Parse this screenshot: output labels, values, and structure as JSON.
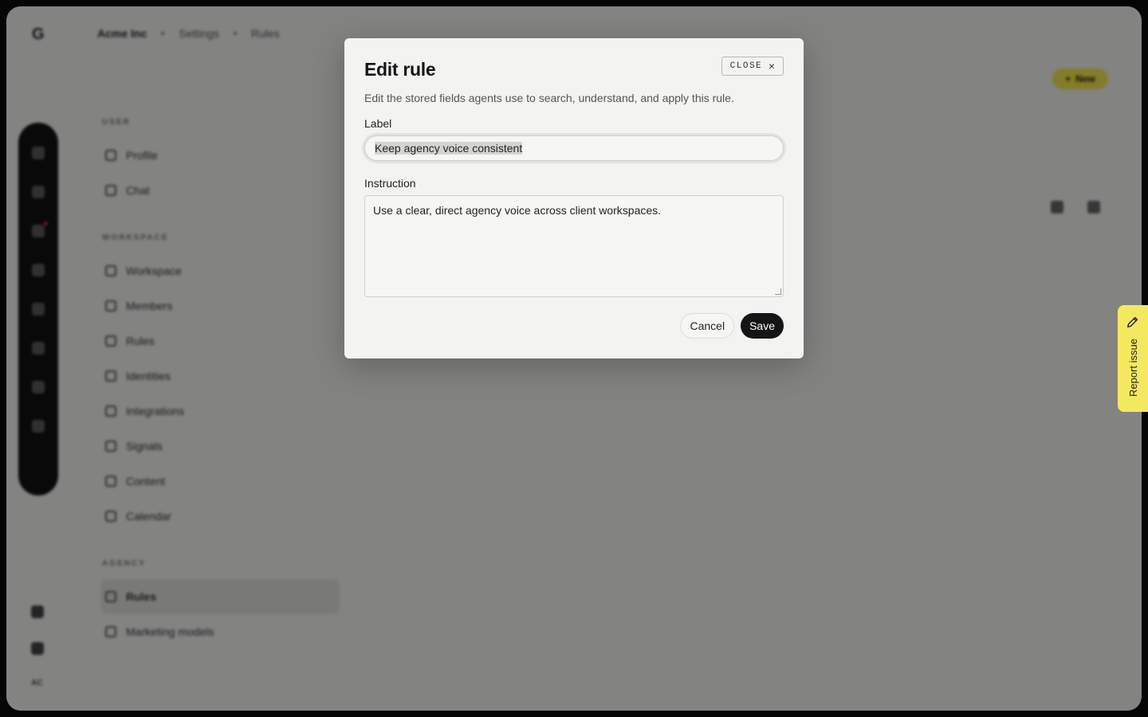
{
  "app": {
    "workspace_name": "Acme Inc",
    "breadcrumb": [
      "Acme Inc",
      "Settings",
      "Rules"
    ],
    "new_button": "New",
    "user_initials": "AC"
  },
  "nav": {
    "sections": [
      {
        "title": "USER",
        "items": [
          "Profile",
          "Chat"
        ]
      },
      {
        "title": "WORKSPACE",
        "items": [
          "Workspace",
          "Members",
          "Rules",
          "Identities",
          "Integrations",
          "Signals",
          "Content",
          "Calendar"
        ]
      },
      {
        "title": "AGENCY",
        "items": [
          "Rules",
          "Marketing models"
        ]
      }
    ],
    "active": "Rules"
  },
  "modal": {
    "title": "Edit rule",
    "close_label": "CLOSE",
    "description": "Edit the stored fields agents use to search, understand, and apply this rule.",
    "label_field_label": "Label",
    "label_value": "Keep agency voice consistent",
    "instruction_field_label": "Instruction",
    "instruction_value": "Use a clear, direct agency voice across client workspaces.",
    "cancel_label": "Cancel",
    "save_label": "Save"
  },
  "report_issue": {
    "label": "Report issue"
  },
  "colors": {
    "accent_yellow": "#f4e860",
    "primary_dark": "#151515",
    "overlay": "rgba(0,0,0,0.46)"
  }
}
